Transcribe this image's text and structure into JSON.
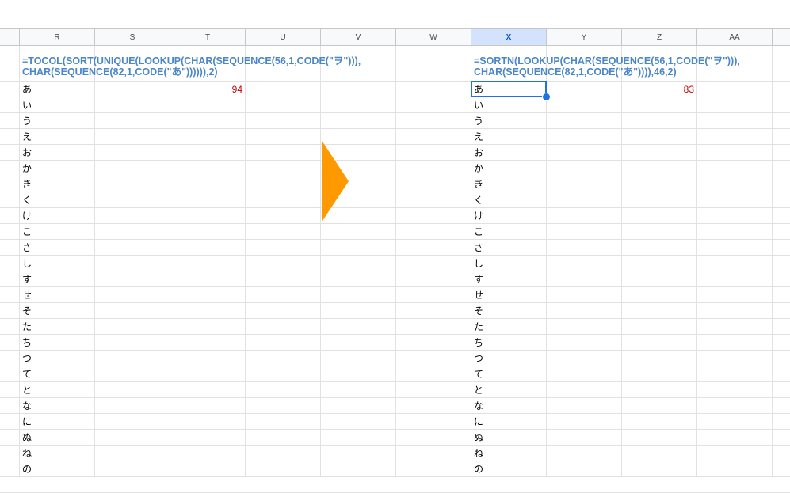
{
  "columns": [
    "R",
    "S",
    "T",
    "U",
    "V",
    "W",
    "X",
    "Y",
    "Z",
    "AA"
  ],
  "selected_column": "X",
  "left_formula": {
    "line1": "=TOCOL(SORT(UNIQUE(LOOKUP(CHAR(SEQUENCE(56,1,CODE(\"ヲ\"))),",
    "line2": "CHAR(SEQUENCE(82,1,CODE(\"あ\")))))),2)"
  },
  "right_formula": {
    "line1": "=SORTN(LOOKUP(CHAR(SEQUENCE(56,1,CODE(\"ヲ\"))),",
    "line2": "CHAR(SEQUENCE(82,1,CODE(\"あ\")))),46,2)"
  },
  "left_count": "94",
  "right_count": "83",
  "kana": [
    "あ",
    "い",
    "う",
    "え",
    "お",
    "か",
    "き",
    "く",
    "け",
    "こ",
    "さ",
    "し",
    "す",
    "せ",
    "そ",
    "た",
    "ち",
    "つ",
    "て",
    "と",
    "な",
    "に",
    "ぬ",
    "ね",
    "の"
  ],
  "arrow_color": "#ff9900"
}
